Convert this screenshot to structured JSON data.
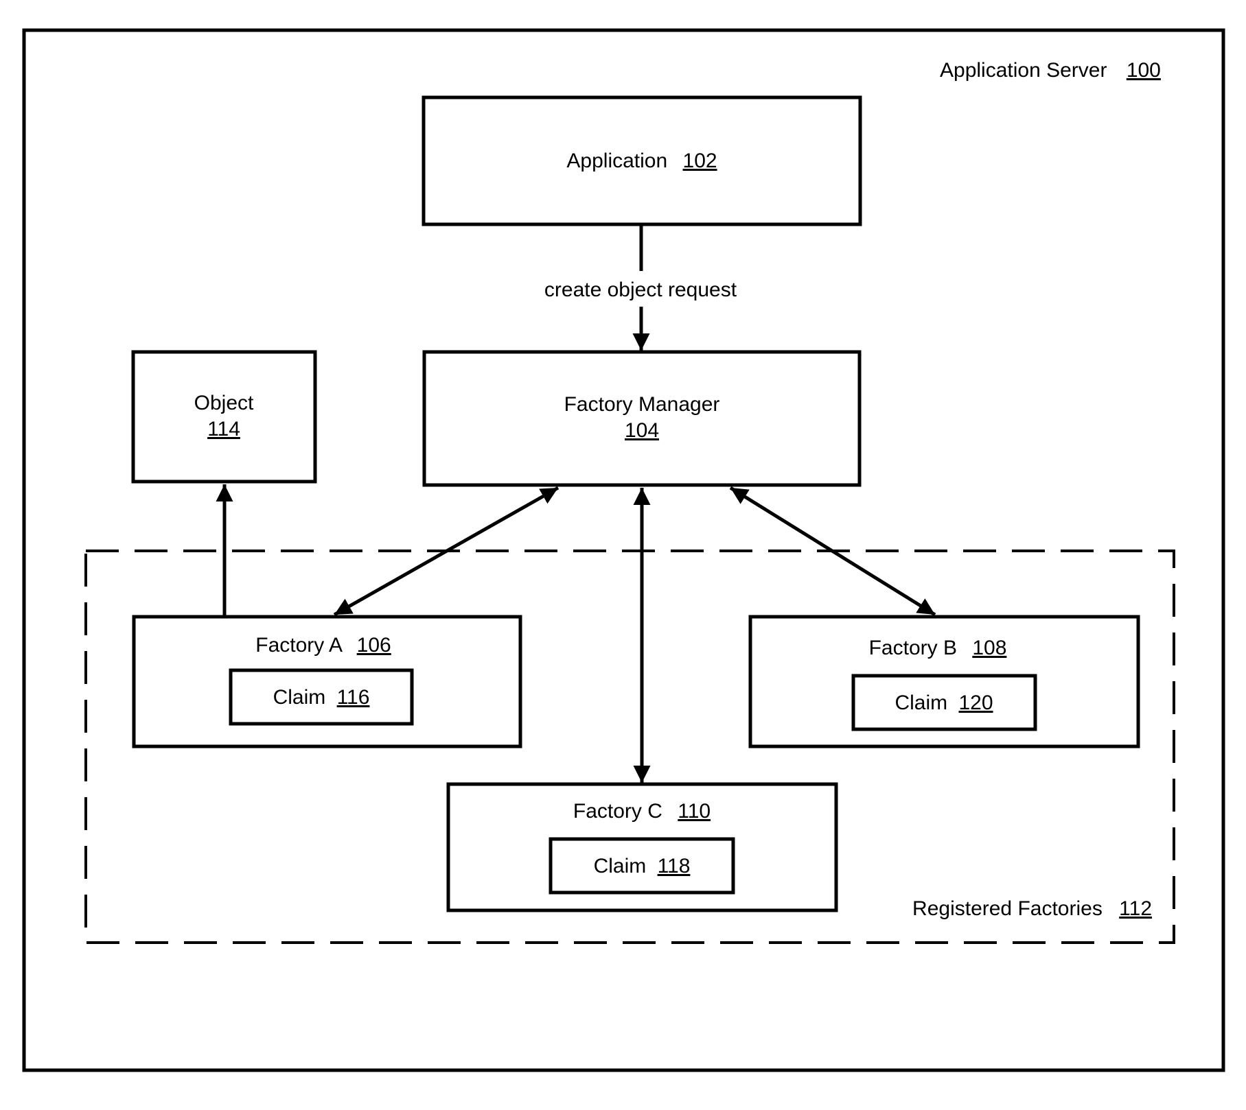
{
  "diagram": {
    "container": {
      "label": "Application Server",
      "ref": "100"
    },
    "group": {
      "label": "Registered Factories",
      "ref": "112",
      "style": "dashed"
    },
    "nodes": {
      "application": {
        "label": "Application",
        "ref": "102"
      },
      "factory_manager": {
        "label": "Factory Manager",
        "ref": "104"
      },
      "object": {
        "label": "Object",
        "ref": "114"
      },
      "factory_a": {
        "label": "Factory A",
        "ref": "106",
        "claim": {
          "label": "Claim",
          "ref": "116"
        }
      },
      "factory_b": {
        "label": "Factory B",
        "ref": "108",
        "claim": {
          "label": "Claim",
          "ref": "120"
        }
      },
      "factory_c": {
        "label": "Factory C",
        "ref": "110",
        "claim": {
          "label": "Claim",
          "ref": "118"
        }
      }
    },
    "edges": [
      {
        "from": "application",
        "to": "factory_manager",
        "label": "create object request",
        "direction": "forward"
      },
      {
        "from": "factory_manager",
        "to": "factory_a",
        "label": "",
        "direction": "both"
      },
      {
        "from": "factory_manager",
        "to": "factory_b",
        "label": "",
        "direction": "both"
      },
      {
        "from": "factory_manager",
        "to": "factory_c",
        "label": "",
        "direction": "both"
      },
      {
        "from": "factory_a",
        "to": "object",
        "label": "",
        "direction": "forward"
      }
    ],
    "colors": {
      "stroke": "#000000",
      "background": "#ffffff"
    }
  }
}
